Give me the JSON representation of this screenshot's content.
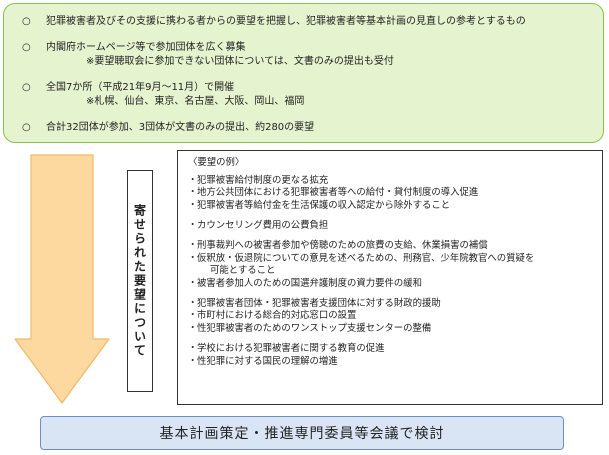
{
  "top_box": {
    "bullet_mark": "○",
    "items": [
      {
        "text": "犯罪被害者及びその支援に携わる者からの要望を把握し、犯罪被害者等基本計画の見直しの参考とするもの",
        "sub": ""
      },
      {
        "text": "内閣府ホームページ等で参加団体を広く募集",
        "sub": "※要望聴取会に参加できない団体については、文書のみの提出も受付"
      },
      {
        "text": "全国7か所（平成21年9月～11月）で開催",
        "sub": "※札幌、仙台、東京、名古屋、大阪、岡山、福岡"
      },
      {
        "text": "合計32団体が参加、3団体が文書のみの提出、約280の要望",
        "sub": ""
      }
    ]
  },
  "side_label": "寄せられた要望について",
  "examples": {
    "title": "〈要望の例〉",
    "dot": "・",
    "groups": [
      {
        "items": [
          {
            "text": "犯罪被害給付制度の更なる拡充"
          },
          {
            "text": "地方公共団体における犯罪被害者等への給付・貸付制度の導入促進"
          },
          {
            "text": "犯罪被害者等給付金を生活保護の収入認定から除外すること"
          }
        ]
      },
      {
        "items": [
          {
            "text": "カウンセリング費用の公費負担"
          }
        ]
      },
      {
        "items": [
          {
            "text": "刑事裁判への被害者参加や傍聴のための旅費の支給、休業損害の補償"
          },
          {
            "text": "仮釈放・仮退院についての意見を述べるための、刑務官、少年院教官への質疑を",
            "cont": "可能とすること"
          },
          {
            "text": "被害者参加人のための国選弁護制度の資力要件の緩和"
          }
        ]
      },
      {
        "items": [
          {
            "text": "犯罪被害者団体・犯罪被害者支援団体に対する財政的援助"
          },
          {
            "text": "市町村における総合的対応窓口の設置"
          },
          {
            "text": "性犯罪被害者のためのワンストップ支援センターの整備"
          }
        ]
      },
      {
        "items": [
          {
            "text": "学校における犯罪被害者に関する教育の促進"
          },
          {
            "text": "性犯罪に対する国民の理解の増進"
          }
        ]
      }
    ]
  },
  "bottom_box": "基本計画策定・推進専門委員等会議で検討",
  "colors": {
    "top_fill": "#e6f3cf",
    "top_border": "#8cbf4f",
    "arrow_fill": "#fdd9a0",
    "arrow_border": "#f0b966",
    "bottom_fill": "#d9e5f5",
    "bottom_border": "#6f8fc4"
  }
}
